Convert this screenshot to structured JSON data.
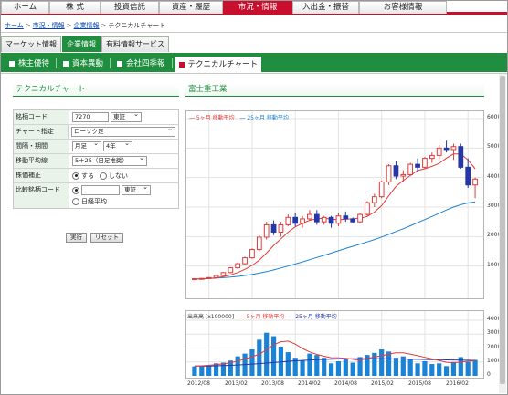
{
  "nav": {
    "items": [
      "ホーム",
      "株 式",
      "投資信託",
      "資産・履歴",
      "市況・情報",
      "入出金・振替",
      "お客様情報"
    ],
    "active_index": 4,
    "accent": "#c8102e"
  },
  "breadcrumb": [
    "ホーム",
    "市況・情報",
    "企業情報",
    "テクニカルチャート"
  ],
  "subtabs": [
    "マーケット情報",
    "企業情報",
    "有料情報サービス"
  ],
  "subtab_active": 1,
  "menu": [
    "株主優待",
    "資本異動",
    "会社四季報",
    "テクニカルチャート"
  ],
  "menu_active": 3,
  "brand_green": "#1f8f3f",
  "left_section_title": "テクニカルチャート",
  "right_section_title": "富士重工業",
  "form": {
    "code_label": "銘柄コード",
    "code_value": "7270",
    "market_value": "東証",
    "chart_label": "チャート指定",
    "chart_value": "ローソク足",
    "period_label": "間隔・期間",
    "interval_value": "月足",
    "years_value": "4年",
    "ma_label": "移動平均線",
    "ma_value": "5＋25（日足推奨）",
    "adjust_label": "株価補正",
    "adjust_on": "する",
    "adjust_off": "しない",
    "compare_label": "比較銘柄コード",
    "compare_market": "東証",
    "compare_index": "日経平均",
    "submit": "実行",
    "reset": "リセット"
  },
  "price_legend": {
    "ma5": "5ヶ月 移動平均",
    "ma25": "25ヶ月 移動平均"
  },
  "volume_legend": {
    "title": "出来高 [x100000]",
    "ma5": "5ヶ月 移動平均",
    "ma25": "25ヶ月 移動平均"
  },
  "y_ticks": [
    "6000",
    "5000",
    "4000",
    "3000",
    "2000",
    "1000"
  ],
  "vol_ticks": [
    "4000",
    "3000",
    "2000",
    "1000",
    "0"
  ],
  "x_ticks": [
    "2012/08",
    "2013/02",
    "2013/08",
    "2014/02",
    "2014/08",
    "2015/02",
    "2015/08",
    "2016/02"
  ],
  "chart_data": {
    "type": "candlestick",
    "title": "富士重工業",
    "ylim": [
      0,
      6000
    ],
    "x_ticks": [
      "2012/08",
      "2013/02",
      "2013/08",
      "2014/02",
      "2014/08",
      "2015/02",
      "2015/08",
      "2016/02"
    ],
    "candles": [
      [
        560,
        580,
        540,
        570
      ],
      [
        570,
        600,
        550,
        580
      ],
      [
        580,
        620,
        560,
        610
      ],
      [
        610,
        690,
        600,
        680
      ],
      [
        680,
        800,
        660,
        780
      ],
      [
        780,
        960,
        760,
        940
      ],
      [
        940,
        1120,
        900,
        1080
      ],
      [
        1080,
        1320,
        1040,
        1280
      ],
      [
        1280,
        1600,
        1250,
        1560
      ],
      [
        1560,
        2050,
        1500,
        1980
      ],
      [
        1980,
        2500,
        1900,
        2400
      ],
      [
        2400,
        2550,
        2050,
        2150
      ],
      [
        2150,
        2500,
        2000,
        2400
      ],
      [
        2400,
        2750,
        2350,
        2650
      ],
      [
        2650,
        2800,
        2350,
        2450
      ],
      [
        2450,
        2700,
        2300,
        2600
      ],
      [
        2600,
        2900,
        2550,
        2750
      ],
      [
        2750,
        2900,
        2400,
        2500
      ],
      [
        2500,
        2700,
        2400,
        2650
      ],
      [
        2650,
        2700,
        2300,
        2450
      ],
      [
        2450,
        2800,
        2350,
        2700
      ],
      [
        2700,
        2850,
        2500,
        2600
      ],
      [
        2600,
        2650,
        2450,
        2500
      ],
      [
        2500,
        2800,
        2450,
        2750
      ],
      [
        2750,
        3200,
        2700,
        3150
      ],
      [
        3150,
        3450,
        3000,
        3350
      ],
      [
        3350,
        3900,
        3300,
        3850
      ],
      [
        3850,
        4450,
        3750,
        4400
      ],
      [
        4400,
        4550,
        3950,
        4050
      ],
      [
        4050,
        4250,
        3850,
        4100
      ],
      [
        4100,
        4500,
        4050,
        4450
      ],
      [
        4450,
        4650,
        4200,
        4350
      ],
      [
        4350,
        4700,
        4300,
        4650
      ],
      [
        4650,
        4850,
        4500,
        4750
      ],
      [
        4750,
        5100,
        4600,
        5000
      ],
      [
        5000,
        5250,
        4850,
        4950
      ],
      [
        4950,
        5150,
        4600,
        5050
      ],
      [
        5050,
        5150,
        4300,
        4350
      ],
      [
        4350,
        4650,
        3650,
        3750
      ],
      [
        3750,
        4000,
        3300,
        3950
      ]
    ],
    "ma5": [
      560,
      570,
      585,
      600,
      640,
      700,
      780,
      890,
      1020,
      1200,
      1440,
      1700,
      1920,
      2150,
      2330,
      2450,
      2550,
      2600,
      2620,
      2590,
      2570,
      2590,
      2600,
      2620,
      2680,
      2830,
      3050,
      3390,
      3700,
      3900,
      4070,
      4240,
      4300,
      4380,
      4480,
      4660,
      4800,
      4800,
      4600,
      4300
    ],
    "ma25": [
      560,
      565,
      575,
      590,
      605,
      625,
      650,
      680,
      715,
      760,
      810,
      870,
      935,
      1000,
      1070,
      1140,
      1215,
      1290,
      1365,
      1440,
      1520,
      1595,
      1670,
      1745,
      1820,
      1900,
      1985,
      2075,
      2170,
      2265,
      2365,
      2470,
      2575,
      2680,
      2790,
      2900,
      3000,
      3080,
      3140,
      3180
    ],
    "volume": [
      680,
      700,
      740,
      900,
      950,
      1100,
      1400,
      1600,
      1900,
      2600,
      3100,
      2850,
      2100,
      1700,
      1300,
      1100,
      1600,
      1500,
      1300,
      900,
      1050,
      1200,
      950,
      1350,
      1500,
      1650,
      1900,
      1750,
      1300,
      1400,
      1200,
      900,
      1050,
      850,
      900,
      700,
      1000,
      1350,
      1000,
      1150
    ],
    "volume_ma5": [
      700,
      720,
      760,
      800,
      860,
      940,
      1060,
      1210,
      1380,
      1550,
      1880,
      2240,
      2450,
      2500,
      2280,
      1970,
      1720,
      1540,
      1410,
      1300,
      1300,
      1260,
      1190,
      1120,
      1250,
      1350,
      1440,
      1570,
      1650,
      1650,
      1560,
      1450,
      1330,
      1220,
      1100,
      980,
      940,
      990,
      1050,
      1090
    ],
    "volume_ma25": [
      700,
      705,
      710,
      720,
      735,
      755,
      780,
      810,
      845,
      880,
      920,
      960,
      1000,
      1040,
      1080,
      1110,
      1140,
      1160,
      1180,
      1200,
      1210,
      1220,
      1230,
      1230,
      1230,
      1230,
      1225,
      1220,
      1215,
      1210,
      1200,
      1190,
      1180,
      1170,
      1160,
      1150,
      1140,
      1130,
      1120,
      1110
    ],
    "legend": [
      "5ヶ月 移動平均",
      "25ヶ月 移動平均"
    ],
    "colors": {
      "up": "#e23b3b",
      "down": "#2437a8",
      "ma5": "#e23b3b",
      "ma25": "#1b83d6",
      "volume_bar": "#1b83d6",
      "volume_ma25": "#2437a8"
    }
  }
}
